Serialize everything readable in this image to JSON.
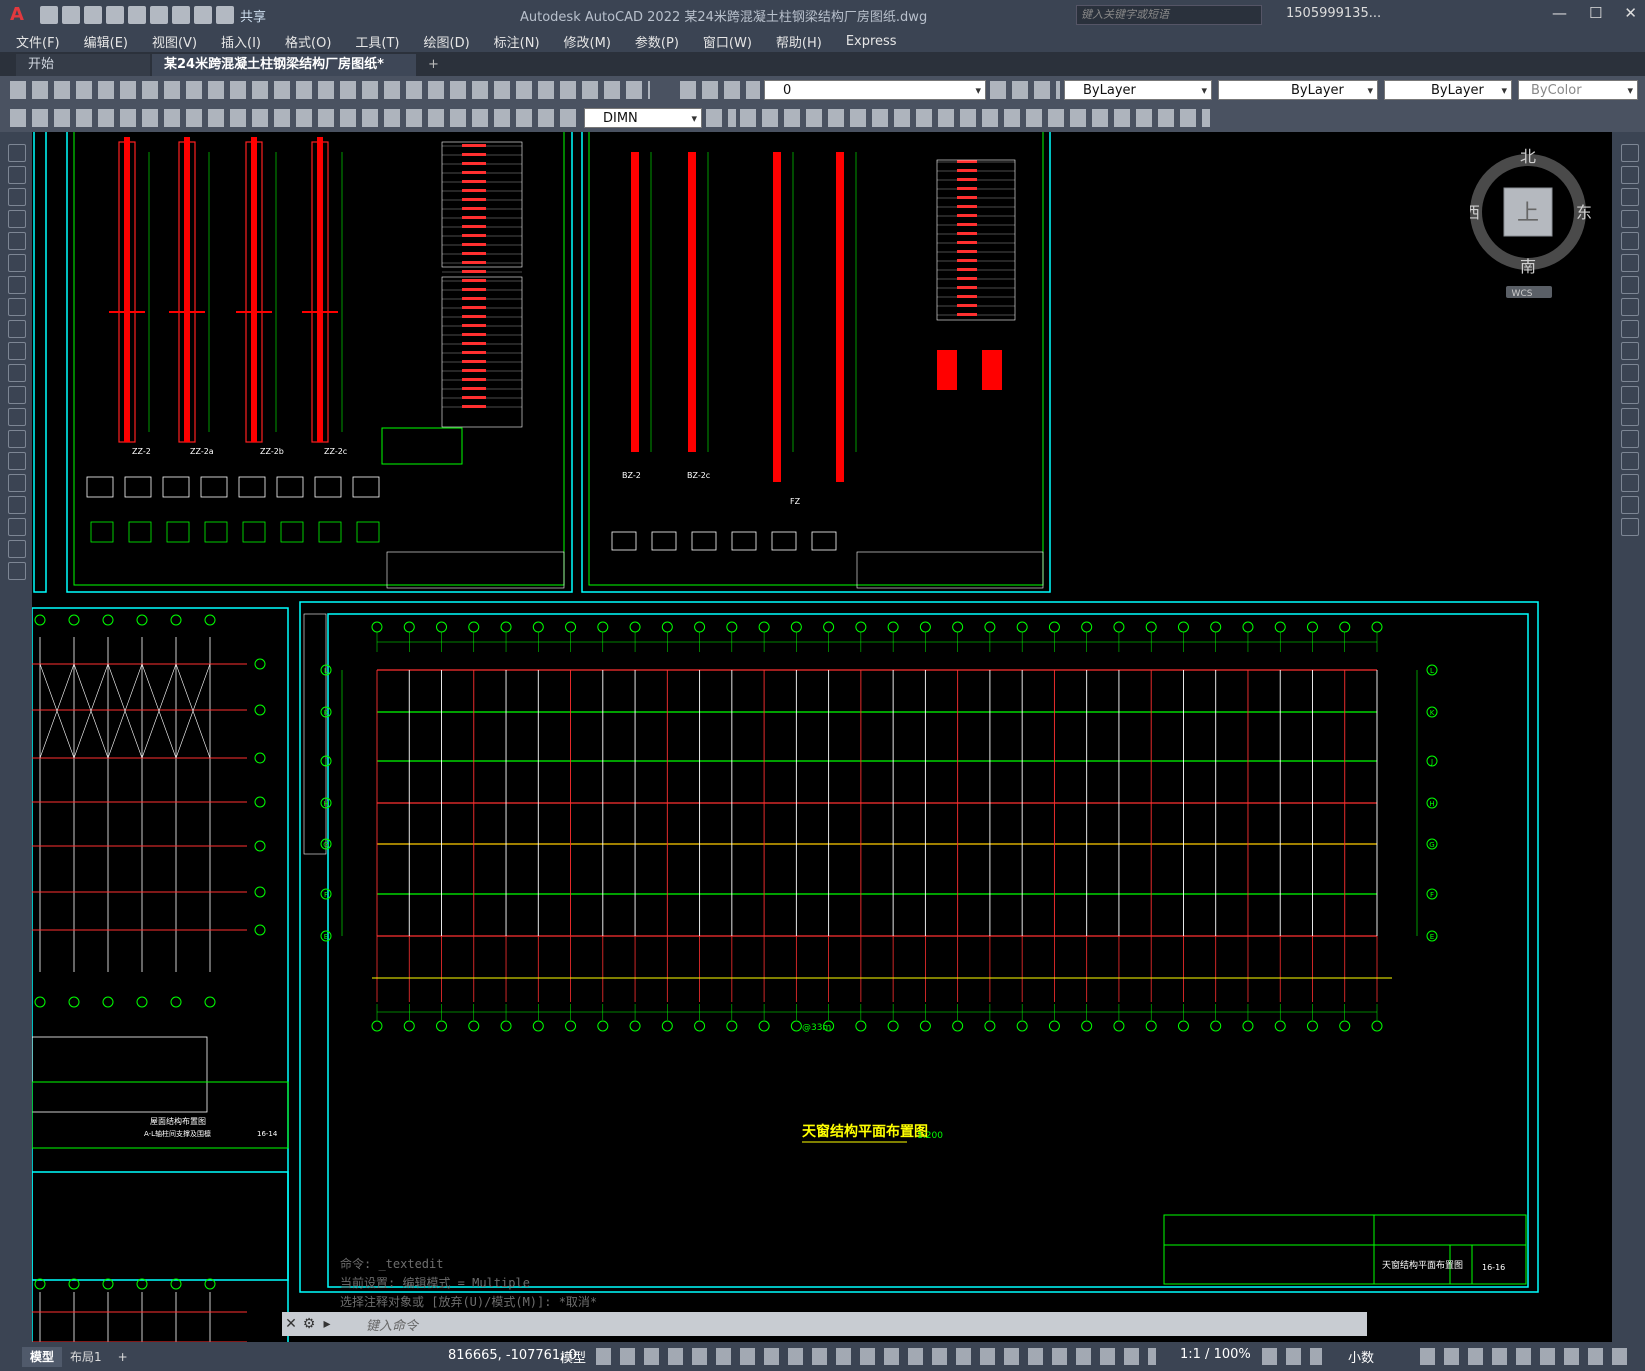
{
  "titlebar": {
    "app_title": "Autodesk AutoCAD 2022    某24米跨混凝土柱钢梁结构厂房图纸.dwg",
    "share": "共享",
    "search_placeholder": "键入关键字或短语",
    "user": "1505999135...",
    "help": "?"
  },
  "menu": [
    "文件(F)",
    "编辑(E)",
    "视图(V)",
    "插入(I)",
    "格式(O)",
    "工具(T)",
    "绘图(D)",
    "标注(N)",
    "修改(M)",
    "参数(P)",
    "窗口(W)",
    "帮助(H)",
    "Express"
  ],
  "tabs": {
    "start": "开始",
    "active": "某24米跨混凝土柱钢梁结构厂房图纸*"
  },
  "toolbar": {
    "layer_value": "0",
    "color": "ByLayer",
    "linetype": "ByLayer",
    "lineweight": "ByLayer",
    "plotstyle": "ByColor",
    "dimstyle": "DIMN"
  },
  "viewcube": {
    "north": "北",
    "south": "南",
    "east": "东",
    "west": "西",
    "top": "上",
    "wcs": "WCS"
  },
  "drawing": {
    "main_title": "天窗结构平面布置图",
    "main_scale": "1:200",
    "main_number": "16-16",
    "tb_main": "天窗结构平面布置图",
    "left_title": "屋面结构布置图",
    "left_sub": "A-L轴柱间支撑及围檩",
    "left_number": "16-14",
    "center_label": "@33m",
    "col_ZZ2": "ZZ-2",
    "col_ZZ2a": "ZZ-2a",
    "col_ZZ2b": "ZZ-2b",
    "col_ZZ2c": "ZZ-2c",
    "col_BZ2": "BZ-2",
    "col_BZ2c": "BZ-2c",
    "col_FZ": "FZ",
    "grid_rows": [
      "L",
      "K",
      "J",
      "H",
      "G",
      "F",
      "E"
    ]
  },
  "command": {
    "history": [
      "命令: _textedit",
      "当前设置: 编辑模式 = Multiple",
      "选择注释对象或 [放弃(U)/模式(M)]: *取消*"
    ],
    "placeholder": "键入命令"
  },
  "status": {
    "model_tab": "模型",
    "layout_tab": "布局1",
    "add": "+",
    "coords": "816665, -107761, 0",
    "model": "模型",
    "scale": "1:1 / 100%",
    "units": "小数"
  }
}
